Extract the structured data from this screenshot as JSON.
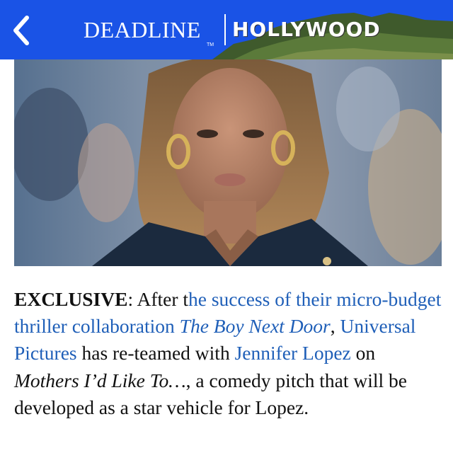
{
  "header": {
    "back_icon": "chevron-left-icon",
    "logo_deadline": "DEADLINE",
    "logo_hollywood": "HOLLYWOOD",
    "logo_tm": "TM",
    "colors": {
      "bar": "#1a53e6",
      "hills": "#3f5a2c"
    }
  },
  "photo": {
    "subject": "woman with hoop earrings in dark blazer"
  },
  "article": {
    "exclusive": "EXCLUSIVE",
    "colon": ": After t",
    "link_success": "he success of their micro-budget thriller collaboration ",
    "link_movie_title": "The Boy Next Door",
    "comma1": ", ",
    "link_universal": "Universal Pictures",
    "text_has": " has re-teamed with ",
    "link_lopez": "Jennifer Lopez",
    "text_on": " on ",
    "movie2": "Mothers I’d Like To…",
    "text_rest": ", a comedy pitch that will be developed as a star vehicle for Lopez.",
    "link_color": "#1f5fb8"
  }
}
